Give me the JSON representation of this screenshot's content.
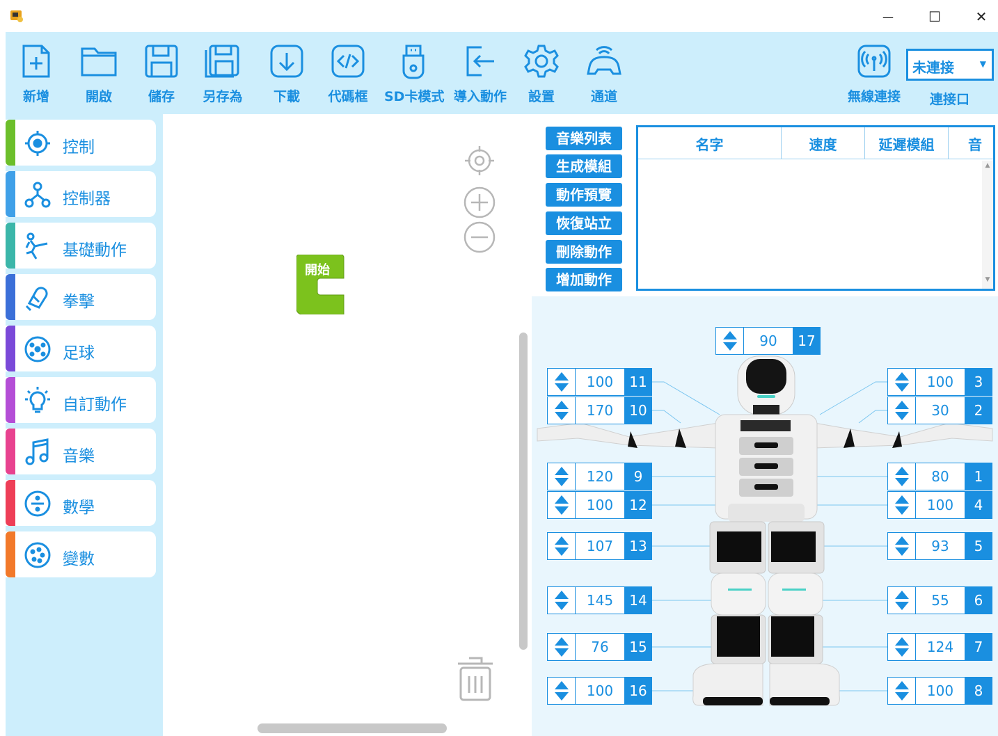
{
  "window": {
    "minimize": "—",
    "maximize": "☐",
    "close": "✕"
  },
  "toolbar": {
    "items": [
      {
        "label": "新增",
        "icon": "new-file-icon"
      },
      {
        "label": "開啟",
        "icon": "folder-icon"
      },
      {
        "label": "儲存",
        "icon": "save-icon"
      },
      {
        "label": "另存為",
        "icon": "save-as-icon"
      },
      {
        "label": "下載",
        "icon": "download-icon"
      },
      {
        "label": "代碼框",
        "icon": "code-icon"
      },
      {
        "label": "SD卡模式",
        "icon": "sd-card-icon"
      },
      {
        "label": "導入動作",
        "icon": "import-icon"
      },
      {
        "label": "設置",
        "icon": "gear-icon"
      },
      {
        "label": "通道",
        "icon": "channel-icon"
      }
    ],
    "wireless_label": "無線連接",
    "connection_value": "未連接",
    "port_label": "連接口"
  },
  "categories": [
    {
      "label": "控制",
      "color": "#6cbf2b",
      "icon": "control-icon"
    },
    {
      "label": "控制器",
      "color": "#3fa0e8",
      "icon": "controller-icon"
    },
    {
      "label": "基礎動作",
      "color": "#3bb6a9",
      "icon": "kick-icon"
    },
    {
      "label": "拳擊",
      "color": "#3b6fd8",
      "icon": "boxing-icon"
    },
    {
      "label": "足球",
      "color": "#7a49d8",
      "icon": "football-icon"
    },
    {
      "label": "自訂動作",
      "color": "#b44ed6",
      "icon": "lightbulb-icon"
    },
    {
      "label": "音樂",
      "color": "#e8428f",
      "icon": "music-icon"
    },
    {
      "label": "數學",
      "color": "#ee3e57",
      "icon": "math-icon"
    },
    {
      "label": "變數",
      "color": "#f2792a",
      "icon": "variable-icon"
    }
  ],
  "workspace": {
    "start_block": "開始",
    "start_color": "#7cc21d"
  },
  "actions": [
    "音樂列表",
    "生成模組",
    "動作預覽",
    "恢復站立",
    "刪除動作",
    "增加動作"
  ],
  "music_table": {
    "columns": [
      "名字",
      "速度",
      "延遲模組",
      "音"
    ]
  },
  "servos": {
    "head": {
      "value": "90",
      "id": "17"
    },
    "left": [
      {
        "value": "100",
        "id": "11"
      },
      {
        "value": "170",
        "id": "10"
      },
      {
        "value": "120",
        "id": "9"
      },
      {
        "value": "100",
        "id": "12"
      },
      {
        "value": "107",
        "id": "13"
      },
      {
        "value": "145",
        "id": "14"
      },
      {
        "value": "76",
        "id": "15"
      },
      {
        "value": "100",
        "id": "16"
      }
    ],
    "right": [
      {
        "value": "100",
        "id": "3"
      },
      {
        "value": "30",
        "id": "2"
      },
      {
        "value": "80",
        "id": "1"
      },
      {
        "value": "100",
        "id": "4"
      },
      {
        "value": "93",
        "id": "5"
      },
      {
        "value": "55",
        "id": "6"
      },
      {
        "value": "124",
        "id": "7"
      },
      {
        "value": "100",
        "id": "8"
      }
    ]
  },
  "colors": {
    "accent": "#1a8fe0",
    "toolbar_bg": "#cdeefc"
  }
}
